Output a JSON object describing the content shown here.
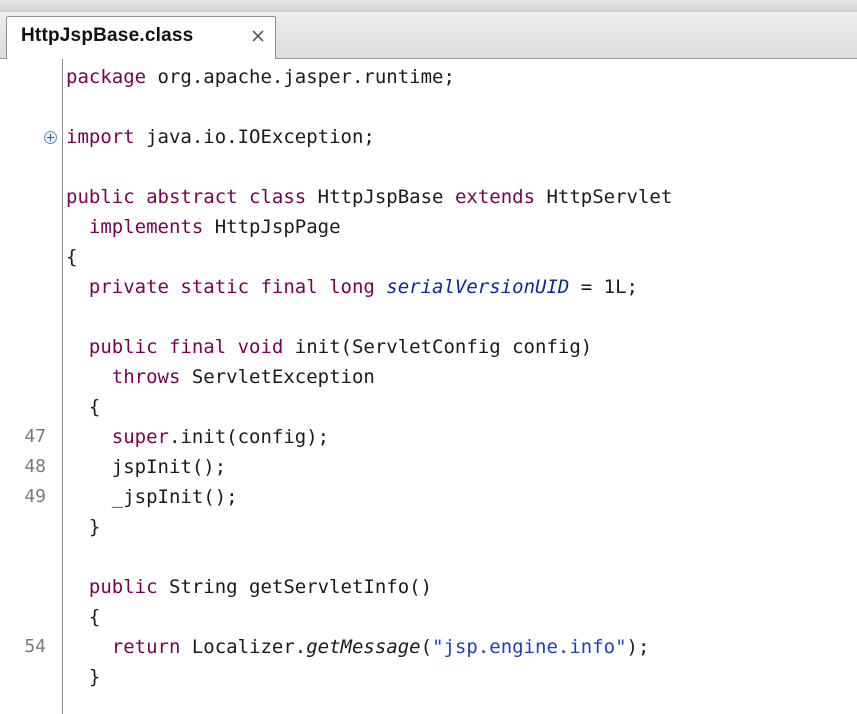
{
  "tab": {
    "title": "HttpJspBase.class",
    "close_icon": "close-icon"
  },
  "lines": [
    {
      "num": "",
      "tokens": [
        {
          "t": "package",
          "c": "kw"
        },
        {
          "t": " org.apache.jasper.runtime;",
          "c": "plain"
        }
      ]
    },
    {
      "num": "",
      "tokens": []
    },
    {
      "num": "",
      "fold": "expand-icon",
      "tokens": [
        {
          "t": "import",
          "c": "kw"
        },
        {
          "t": " java.io.IOException;",
          "c": "plain"
        }
      ]
    },
    {
      "num": "",
      "tokens": []
    },
    {
      "num": "",
      "tokens": [
        {
          "t": "public abstract class",
          "c": "kw"
        },
        {
          "t": " HttpJspBase ",
          "c": "plain"
        },
        {
          "t": "extends",
          "c": "kw"
        },
        {
          "t": " HttpServlet",
          "c": "plain"
        }
      ]
    },
    {
      "num": "",
      "tokens": [
        {
          "t": "  implements",
          "c": "kw"
        },
        {
          "t": " HttpJspPage",
          "c": "plain"
        }
      ]
    },
    {
      "num": "",
      "tokens": [
        {
          "t": "{",
          "c": "plain"
        }
      ]
    },
    {
      "num": "",
      "tokens": [
        {
          "t": "  private static final long ",
          "c": "kw"
        },
        {
          "t": "serialVersionUID",
          "c": "italic"
        },
        {
          "t": " = 1L;",
          "c": "plain"
        }
      ]
    },
    {
      "num": "",
      "tokens": []
    },
    {
      "num": "",
      "tokens": [
        {
          "t": "  public final void",
          "c": "kw"
        },
        {
          "t": " init(ServletConfig config)",
          "c": "plain"
        }
      ]
    },
    {
      "num": "",
      "tokens": [
        {
          "t": "    throws",
          "c": "kw"
        },
        {
          "t": " ServletException",
          "c": "plain"
        }
      ]
    },
    {
      "num": "",
      "tokens": [
        {
          "t": "  {",
          "c": "plain"
        }
      ]
    },
    {
      "num": "47",
      "tokens": [
        {
          "t": "    super",
          "c": "kw"
        },
        {
          "t": ".init(config);",
          "c": "plain"
        }
      ]
    },
    {
      "num": "48",
      "tokens": [
        {
          "t": "    jspInit();",
          "c": "plain"
        }
      ]
    },
    {
      "num": "49",
      "tokens": [
        {
          "t": "    _jspInit();",
          "c": "plain"
        }
      ]
    },
    {
      "num": "",
      "tokens": [
        {
          "t": "  }",
          "c": "plain"
        }
      ]
    },
    {
      "num": "",
      "tokens": []
    },
    {
      "num": "",
      "tokens": [
        {
          "t": "  public",
          "c": "kw"
        },
        {
          "t": " String getServletInfo()",
          "c": "plain"
        }
      ]
    },
    {
      "num": "",
      "tokens": [
        {
          "t": "  {",
          "c": "plain"
        }
      ]
    },
    {
      "num": "54",
      "tokens": [
        {
          "t": "    return",
          "c": "kw"
        },
        {
          "t": " Localizer.",
          "c": "plain"
        },
        {
          "t": "getMessage",
          "c": "method-italic"
        },
        {
          "t": "(",
          "c": "plain"
        },
        {
          "t": "\"jsp.engine.info\"",
          "c": "str"
        },
        {
          "t": ");",
          "c": "plain"
        }
      ]
    },
    {
      "num": "",
      "tokens": [
        {
          "t": "  }",
          "c": "plain"
        }
      ]
    }
  ],
  "colors": {
    "keyword": "#7a0055",
    "field": "#0a2a9a",
    "string": "#1f3fbf",
    "line_number": "#7a7a7a"
  }
}
